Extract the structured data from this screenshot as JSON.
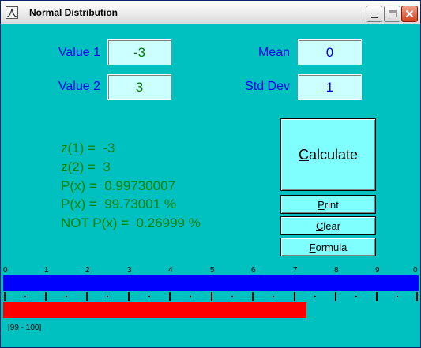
{
  "window": {
    "title": "Normal Distribution"
  },
  "inputs": {
    "value1_label": "Value 1",
    "value1": "-3",
    "value2_label": "Value 2",
    "value2": "3",
    "mean_label": "Mean",
    "mean": "0",
    "std_label": "Std Dev",
    "std": "1"
  },
  "results": {
    "z1": "z(1) =  -3",
    "z2": "z(2) =  3",
    "px": "P(x) =  0.99730007",
    "px_pct": "P(x) =  99.73001 %",
    "not_px": "NOT P(x) =  0.26999 %"
  },
  "buttons": {
    "calculate_u": "C",
    "calculate_rest": "alculate",
    "print_u": "P",
    "print_rest": "rint",
    "clear_u": "C",
    "clear_rest": "lear",
    "formula_u": "F",
    "formula_rest": "ormula"
  },
  "scale": {
    "labels": [
      "0",
      "1",
      "2",
      "3",
      "4",
      "5",
      "6",
      "7",
      "8",
      "9",
      "0"
    ],
    "range_label": "[99 - 100]",
    "blue_fraction": 1.0,
    "red_fraction": 0.73
  },
  "colors": {
    "background": "#00c0c0",
    "blue_bar": "#0000ff",
    "red_bar": "#ff0000",
    "label_blue": "#0000e6",
    "result_green": "#008000"
  }
}
